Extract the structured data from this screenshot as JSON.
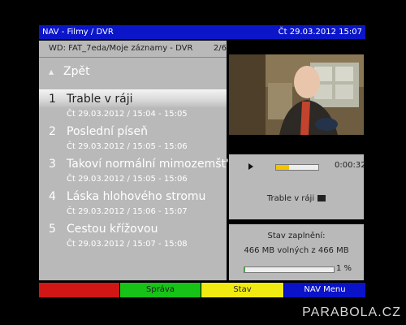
{
  "header": {
    "title": "NAV - Filmy / DVR",
    "datetime": "Čt 29.03.2012  15:07"
  },
  "list": {
    "path": "WD: FAT_7eda/Moje záznamy - DVR",
    "page": "2/6",
    "back_label": "Zpět",
    "items": [
      {
        "num": "1",
        "name": "Trable v ráji",
        "date": "Čt 29.03.2012  / 15:04 - 15:05",
        "selected": true
      },
      {
        "num": "2",
        "name": "Poslední píseň",
        "date": "Čt 29.03.2012  / 15:05 - 15:06"
      },
      {
        "num": "3",
        "name": "Takoví normální mimozemšt'ané ...",
        "date": "Čt 29.03.2012  / 15:05 - 15:06"
      },
      {
        "num": "4",
        "name": "Láska hlohového stromu",
        "date": "Čt 29.03.2012  / 15:06 - 15:07"
      },
      {
        "num": "5",
        "name": "Cestou křížovou",
        "date": "Čt 29.03.2012  / 15:07 - 15:08"
      }
    ]
  },
  "player": {
    "progress": 0.3,
    "time": "0:00:32",
    "title": "Trable v ráji"
  },
  "storage": {
    "label": "Stav zaplnění:",
    "value": "466 MB volných z 466 MB",
    "percent": "1 %",
    "fill": 0.01
  },
  "buttons": {
    "red": "",
    "green": "Správa",
    "yellow": "Stav",
    "blue": "NAV Menu"
  },
  "watermark": "PARABOLA.CZ",
  "colors": {
    "accent_blue": "#0b16c9",
    "red": "#d11616",
    "green": "#17c317",
    "yellow": "#f1ea12",
    "progress_yellow": "#f3c400"
  }
}
